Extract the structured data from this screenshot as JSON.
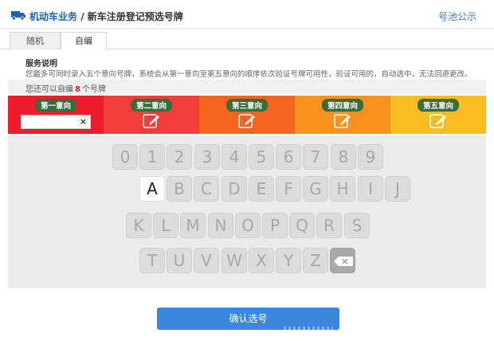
{
  "header": {
    "section": "机动车业务",
    "separator": " / ",
    "title": "新车注册登记预选号牌",
    "link": "号池公示",
    "brand_color": "#1f5fb0"
  },
  "tabs": [
    {
      "label": "随机",
      "active": false
    },
    {
      "label": "自编",
      "active": true
    }
  ],
  "service": {
    "title": "服务说明",
    "description": "您最多可同时录入五个意向号牌，系统会从第一意向至第五意向的顺序依次验证号牌可用性，验证可用的，自动选中，无法回退更改。"
  },
  "count": {
    "prefix": "您还可以自编",
    "number": "8",
    "suffix": "个号牌"
  },
  "choices": [
    {
      "label": "第一意向",
      "color": "#ee1c2c",
      "has_input": true,
      "input_value": "",
      "clear_label": "×"
    },
    {
      "label": "第二意向",
      "color": "#f23d3a",
      "has_input": false,
      "icon": "edit-icon"
    },
    {
      "label": "第三意向",
      "color": "#f6651f",
      "has_input": false,
      "icon": "edit-icon"
    },
    {
      "label": "第四意向",
      "color": "#f7921e",
      "has_input": false,
      "icon": "edit-icon"
    },
    {
      "label": "第五意向",
      "color": "#f7bd22",
      "has_input": false,
      "icon": "edit-icon"
    }
  ],
  "keyboard": {
    "rows": [
      [
        "0",
        "1",
        "2",
        "3",
        "4",
        "5",
        "6",
        "7",
        "8",
        "9"
      ],
      [
        "A",
        "B",
        "C",
        "D",
        "E",
        "F",
        "G",
        "H",
        "I",
        "J"
      ],
      [
        "K",
        "L",
        "M",
        "N",
        "O",
        "P",
        "Q",
        "R",
        "S"
      ],
      [
        "T",
        "U",
        "V",
        "W",
        "X",
        "Y",
        "Z",
        "⌫"
      ]
    ],
    "active_key": "A",
    "delete_icon": "backspace-icon"
  },
  "confirm": {
    "label": "确认选号"
  }
}
